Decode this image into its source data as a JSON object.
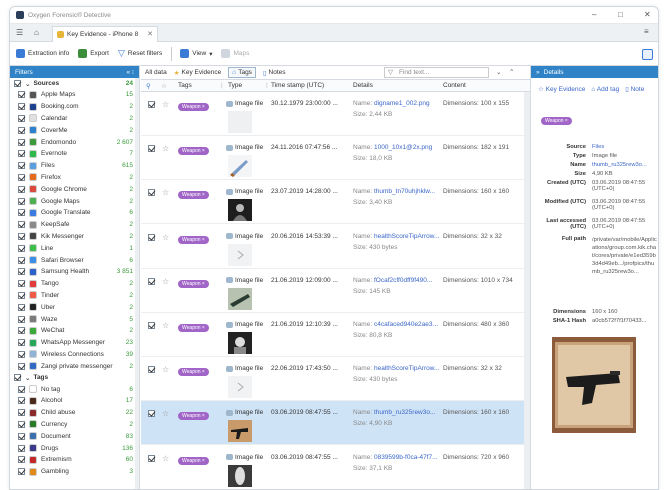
{
  "window": {
    "title": "Oxygen Forensic® Detective"
  },
  "tab": {
    "label": "Key Evidence - iPhone 8"
  },
  "toolbar": {
    "extraction_info": "Extraction info",
    "export": "Export",
    "reset_filters": "Reset filters",
    "view": "View",
    "maps": "Maps"
  },
  "filters": {
    "header": "Filters",
    "sources_label": "Sources",
    "sources_count": "24",
    "sources": [
      {
        "name": "Apple Maps",
        "count": "15",
        "color": "#555555"
      },
      {
        "name": "Booking.com",
        "count": "2",
        "color": "#1f3f8f"
      },
      {
        "name": "Calendar",
        "count": "2",
        "color": "#e0e0e0"
      },
      {
        "name": "CoverMe",
        "count": "2",
        "color": "#2d7fcf"
      },
      {
        "name": "Endomondo",
        "count": "2 607",
        "color": "#3b9a3b"
      },
      {
        "name": "Evernote",
        "count": "7",
        "color": "#2db84a"
      },
      {
        "name": "Files",
        "count": "615",
        "color": "#5aa0e0"
      },
      {
        "name": "Firefox",
        "count": "2",
        "color": "#e66a1e"
      },
      {
        "name": "Google Chrome",
        "count": "2",
        "color": "#d94a3a"
      },
      {
        "name": "Google Maps",
        "count": "2",
        "color": "#4caf50"
      },
      {
        "name": "Google Translate",
        "count": "6",
        "color": "#3a7be0"
      },
      {
        "name": "KeepSafe",
        "count": "2",
        "color": "#8a8a8a"
      },
      {
        "name": "Kik Messenger",
        "count": "2",
        "color": "#444444"
      },
      {
        "name": "Line",
        "count": "1",
        "color": "#3cbf4a"
      },
      {
        "name": "Safari Browser",
        "count": "6",
        "color": "#3a8ee6"
      },
      {
        "name": "Samsung Health",
        "count": "3 851",
        "color": "#2a62c9"
      },
      {
        "name": "Tango",
        "count": "2",
        "color": "#e23a3a"
      },
      {
        "name": "Tinder",
        "count": "2",
        "color": "#f05a46"
      },
      {
        "name": "Uber",
        "count": "2",
        "color": "#222222"
      },
      {
        "name": "Waze",
        "count": "5",
        "color": "#7a7a7a"
      },
      {
        "name": "WeChat",
        "count": "2",
        "color": "#3aaa3a"
      },
      {
        "name": "WhatsApp Messenger",
        "count": "23",
        "color": "#25a85a"
      },
      {
        "name": "Wireless Connections",
        "count": "39",
        "color": "#8fb4d8"
      },
      {
        "name": "Zangi private messenger",
        "count": "2",
        "color": "#2f6bc5"
      }
    ],
    "tags_label": "Tags",
    "tags": [
      {
        "name": "No tag",
        "count": "6",
        "color": "#ffffff"
      },
      {
        "name": "Alcohol",
        "count": "17",
        "color": "#4a2a1a"
      },
      {
        "name": "Child abuse",
        "count": "22",
        "color": "#8a2a2a"
      },
      {
        "name": "Currency",
        "count": "2",
        "color": "#2a7a2a"
      },
      {
        "name": "Document",
        "count": "83",
        "color": "#3a6fb0"
      },
      {
        "name": "Drugs",
        "count": "136",
        "color": "#3a3a8a"
      },
      {
        "name": "Extremism",
        "count": "60",
        "color": "#c22a2a"
      },
      {
        "name": "Gambling",
        "count": "3",
        "color": "#e08a1a"
      }
    ]
  },
  "center": {
    "subtabs": {
      "all_data": "All data",
      "key_evidence": "Key Evidence",
      "tags": "Tags",
      "notes": "Notes"
    },
    "search_placeholder": "Find text...",
    "columns": {
      "tags": "Tags",
      "type": "Type",
      "timestamp": "Time stamp (UTC)",
      "details": "Details",
      "content": "Content"
    },
    "rows": [
      {
        "tag": "Weapon",
        "type": "Image file",
        "timestamp": "30.12.1979 23:00:00 ...",
        "name": "digname1_002.png",
        "size": "2,44 KB",
        "dimensions": "Dimensions: 100 x 155",
        "selected": false
      },
      {
        "tag": "Weapon",
        "type": "Image file",
        "timestamp": "24.11.2016 07:47:56 ...",
        "name": "1000_10x1@2x.png",
        "size": "18,0 KB",
        "dimensions": "Dimensions: 182 x 191",
        "selected": false
      },
      {
        "tag": "Weapon",
        "type": "Image file",
        "timestamp": "23.07.2019 14:28:00 ...",
        "name": "thumb_tn70uhjhklw...",
        "size": "3,40 KB",
        "dimensions": "Dimensions: 160 x 160",
        "selected": false
      },
      {
        "tag": "Weapon",
        "type": "Image file",
        "timestamp": "20.06.2016 14:53:39 ...",
        "name": "healthScoreTipArrow...",
        "size": "430 bytes",
        "dimensions": "Dimensions: 32 x 32",
        "selected": false
      },
      {
        "tag": "Weapon",
        "type": "Image file",
        "timestamp": "21.06.2019 12:09:00 ...",
        "name": "fOcaf2cff0dff9f490...",
        "size": "145 KB",
        "dimensions": "Dimensions: 1010 x 734",
        "selected": false
      },
      {
        "tag": "Weapon",
        "type": "Image file",
        "timestamp": "21.06.2019 12:10:39 ...",
        "name": "c4cafaced940e2ae3...",
        "size": "80,8 KB",
        "dimensions": "Dimensions: 480 x 360",
        "selected": false
      },
      {
        "tag": "Weapon",
        "type": "Image file",
        "timestamp": "22.06.2019 17:43:50 ...",
        "name": "healthScoreTipArrow...",
        "size": "430 bytes",
        "dimensions": "Dimensions: 32 x 32",
        "selected": false
      },
      {
        "tag": "Weapon",
        "type": "Image file",
        "timestamp": "03.06.2019 08:47:55 ...",
        "name": "thumb_ru325rew3o...",
        "size": "4,90 KB",
        "dimensions": "Dimensions: 160 x 160",
        "selected": true
      },
      {
        "tag": "Weapon",
        "type": "Image file",
        "timestamp": "03.06.2019 08:47:55 ...",
        "name": "0839599b-f0ca-47f7...",
        "size": "37,1 KB",
        "dimensions": "Dimensions: 720 x 960",
        "selected": false
      }
    ],
    "name_prefix": "Name:",
    "size_prefix": "Size:"
  },
  "details": {
    "header": "Details",
    "key_evidence": "Key Evidence",
    "add_tag": "Add tag",
    "note": "Note",
    "tag": "Weapon",
    "props": [
      {
        "k": "Source",
        "v": "Files"
      },
      {
        "k": "Type",
        "v": "Image file"
      },
      {
        "k": "Name",
        "v": "thumb_ru325rew3o..."
      },
      {
        "k": "Size",
        "v": "4,90 KB"
      },
      {
        "k": "Created (UTC)",
        "v": "03.06.2019 08:47:55 (UTC+0)"
      },
      {
        "k": "Modified (UTC)",
        "v": "03.06.2019 08:47:55 (UTC+0)"
      },
      {
        "k": "Last accessed (UTC)",
        "v": "03.06.2019 08:47:55 (UTC+0)"
      },
      {
        "k": "Full path",
        "v": "/private/var/mobile/Applications/group.com.kik.chat/cores/private/e1ed359b3d4d49eb.../profpics/thumb_ru325rew3o..."
      },
      {
        "k": "Dimensions",
        "v": "160 x 160"
      },
      {
        "k": "SHA-1 Hash",
        "v": "a0cb572f7f1f70433..."
      }
    ]
  }
}
